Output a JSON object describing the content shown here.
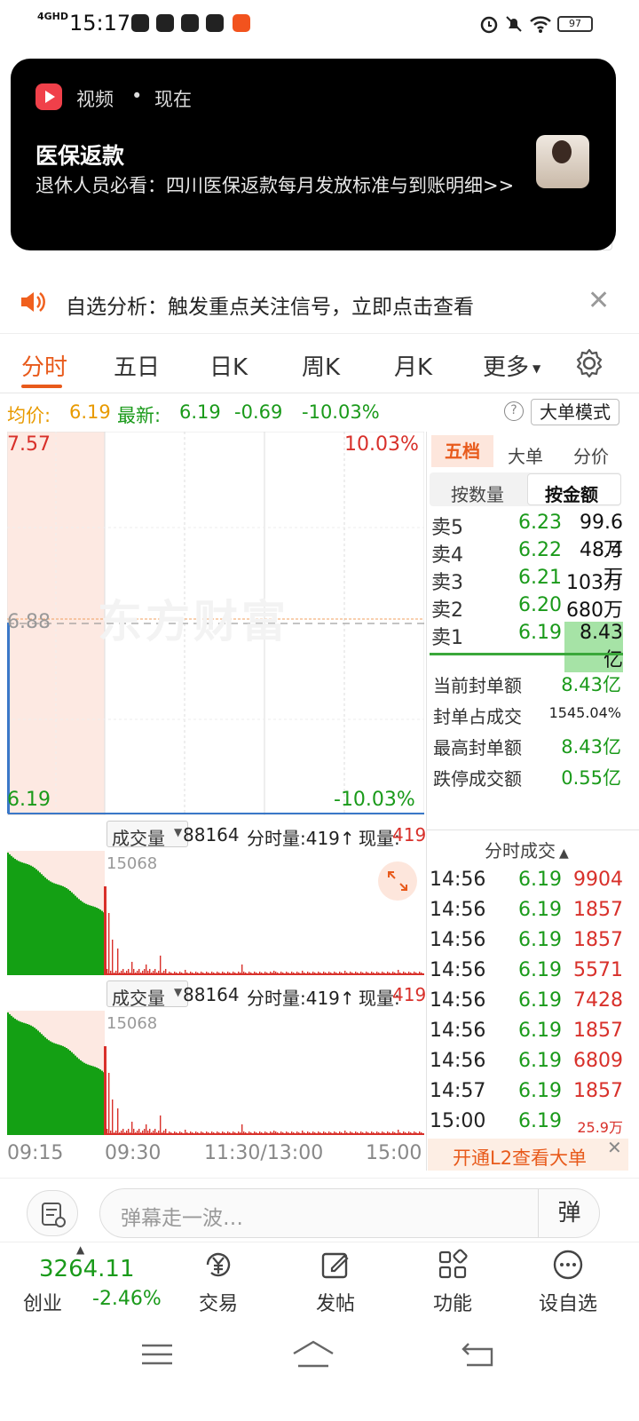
{
  "status_bar": {
    "time": "15:17",
    "network": "4GHD",
    "battery": "97"
  },
  "notification": {
    "app_name": "视频",
    "dot": "•",
    "time": "现在",
    "title": "医保返款",
    "body": "退休人员必看：四川医保返款每月发放标准与到账明细>>"
  },
  "alert_banner": {
    "text": "自选分析：触发重点关注信号，立即点击查看",
    "close": "✕"
  },
  "chart_tabs": [
    "分时",
    "五日",
    "日K",
    "周K",
    "月K",
    "更多"
  ],
  "info": {
    "avg_label": "均价:",
    "avg_value": "6.19",
    "new_label": "最新:",
    "new_value": "6.19",
    "change": "-0.69",
    "change_pct": "-10.03%",
    "help": "?",
    "big_order_mode": "大单模式"
  },
  "price_chart": {
    "high": "7.57",
    "high_pct": "10.03%",
    "mid": "6.88",
    "low": "6.19",
    "low_pct": "-10.03%",
    "watermark": "东方财富"
  },
  "right_panel": {
    "tabs": [
      "五档",
      "大单",
      "分价"
    ],
    "subtabs": [
      "按数量",
      "按金额"
    ],
    "asks": [
      {
        "label": "卖5",
        "price": "6.23",
        "amount": "99.6万"
      },
      {
        "label": "卖4",
        "price": "6.22",
        "amount": "48.4万"
      },
      {
        "label": "卖3",
        "price": "6.21",
        "amount": "103万"
      },
      {
        "label": "卖2",
        "price": "6.20",
        "amount": "680万"
      },
      {
        "label": "卖1",
        "price": "6.19",
        "amount": "8.43亿"
      }
    ],
    "seal": [
      {
        "label": "当前封单额",
        "value": "8.43亿"
      },
      {
        "label": "封单占成交",
        "value": "1545.04%"
      },
      {
        "label": "最高封单额",
        "value": "8.43亿"
      },
      {
        "label": "跌停成交额",
        "value": "0.55亿"
      }
    ]
  },
  "volume": {
    "dropdown": "成交量",
    "total": "88164",
    "min_label": "分时量:419↑",
    "cur_label": "现量:",
    "cur_value": "419",
    "max": "15068"
  },
  "time_axis": [
    "09:15",
    "09:30",
    "11:30/13:00",
    "15:00"
  ],
  "trades": {
    "title": "分时成交",
    "rows": [
      {
        "time": "14:56",
        "price": "6.19",
        "vol": "9904"
      },
      {
        "time": "14:56",
        "price": "6.19",
        "vol": "1857"
      },
      {
        "time": "14:56",
        "price": "6.19",
        "vol": "1857"
      },
      {
        "time": "14:56",
        "price": "6.19",
        "vol": "5571"
      },
      {
        "time": "14:56",
        "price": "6.19",
        "vol": "7428"
      },
      {
        "time": "14:56",
        "price": "6.19",
        "vol": "1857"
      },
      {
        "time": "14:56",
        "price": "6.19",
        "vol": "6809"
      },
      {
        "time": "14:57",
        "price": "6.19",
        "vol": "1857"
      },
      {
        "time": "15:00",
        "price": "6.19",
        "vol": "25.9万"
      }
    ],
    "l2_banner": "开通L2查看大单",
    "l2_close": "✕"
  },
  "barrage": {
    "placeholder": "弹幕走一波…",
    "send": "弹"
  },
  "bottom_nav": {
    "index_value": "3264.11",
    "index_name": "创业",
    "index_pct": "-2.46%",
    "items": [
      "交易",
      "发帖",
      "功能",
      "设自选"
    ]
  },
  "colors": {
    "accent": "#e85a1b",
    "down": "#1a9a1a",
    "up": "#d8302a",
    "auction_bg": "#fde9e2"
  }
}
